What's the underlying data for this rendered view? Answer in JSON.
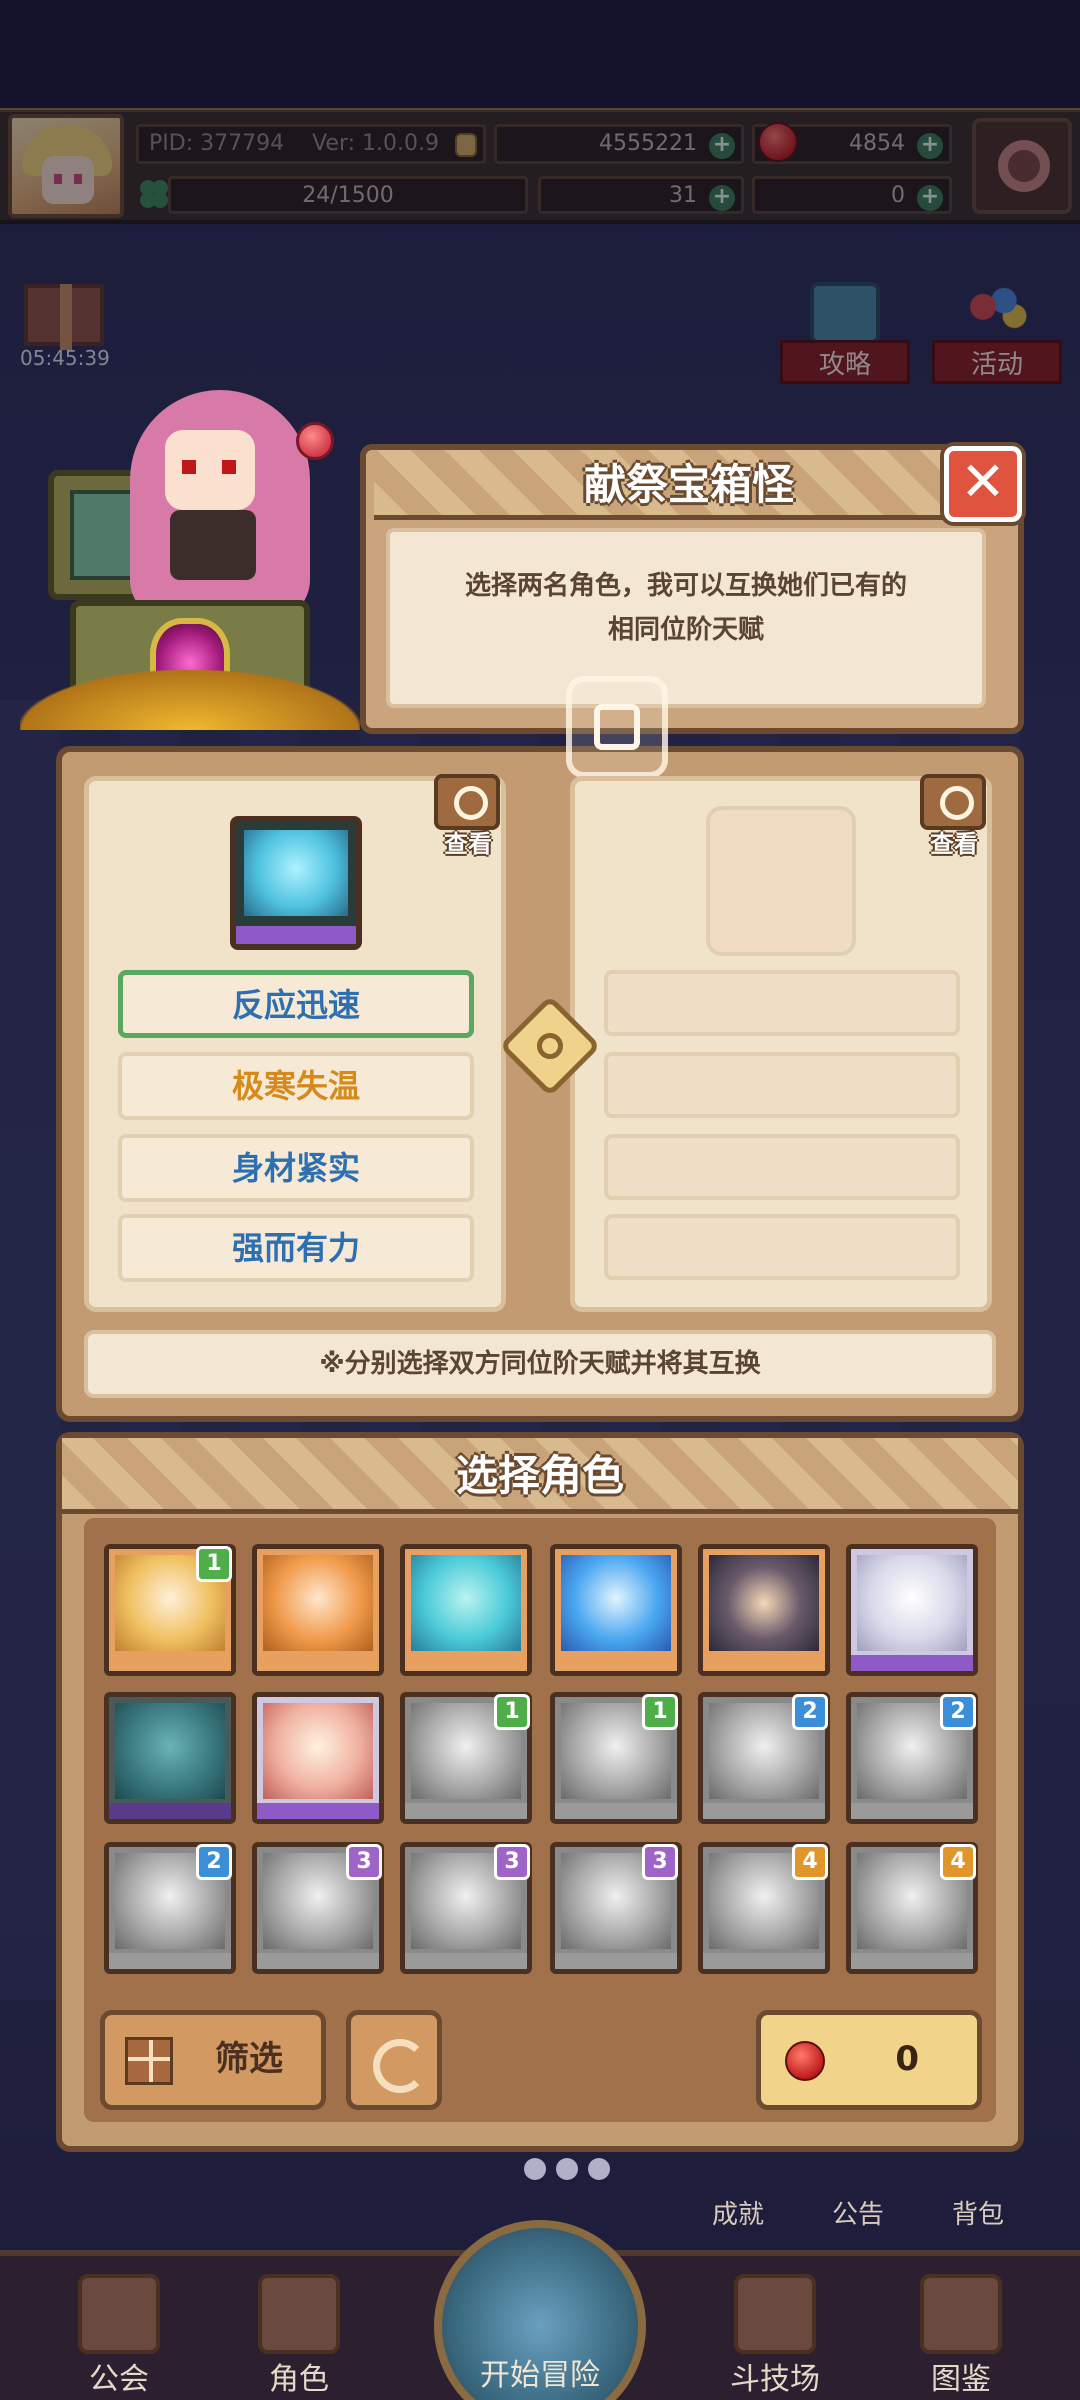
{
  "header": {
    "pid": "PID: 377794",
    "version": "Ver: 1.0.0.9",
    "gold": "4555221",
    "ruby": "4854",
    "stamina": "24/1500",
    "clover": "31",
    "key": "0"
  },
  "timer": "05:45:39",
  "side_buttons": {
    "guide": "攻略",
    "event": "活动"
  },
  "dialog": {
    "title": "献祭宝箱怪",
    "desc_line1": "选择两名角色，我可以互换她们已有的",
    "desc_line2": "相同位阶天赋",
    "close_icon": "✕"
  },
  "swap": {
    "view_label_left": "查看",
    "view_label_right": "查看",
    "talents": [
      "反应迅速",
      "极寒失温",
      "身材紧实",
      "强而有力"
    ],
    "hint": "※分别选择双方同位阶天赋并将其互换"
  },
  "select": {
    "title": "选择角色",
    "filter_label": "筛选",
    "cost_value": "0",
    "badges": {
      "r0c0": "1",
      "r1c2": "1",
      "r1c3": "1",
      "r1c4": "2",
      "r1c5": "2",
      "r2c0": "2",
      "r2c1": "3",
      "r2c2": "3",
      "r2c3": "3",
      "r2c4": "4",
      "r2c5": "4"
    }
  },
  "bottom_menu": {
    "achievement": "成就",
    "notice": "公告",
    "bag": "背包"
  },
  "nav": {
    "guild": "公会",
    "character": "角色",
    "adventure": "开始冒险",
    "arena": "斗技场",
    "gallery": "图鉴"
  }
}
